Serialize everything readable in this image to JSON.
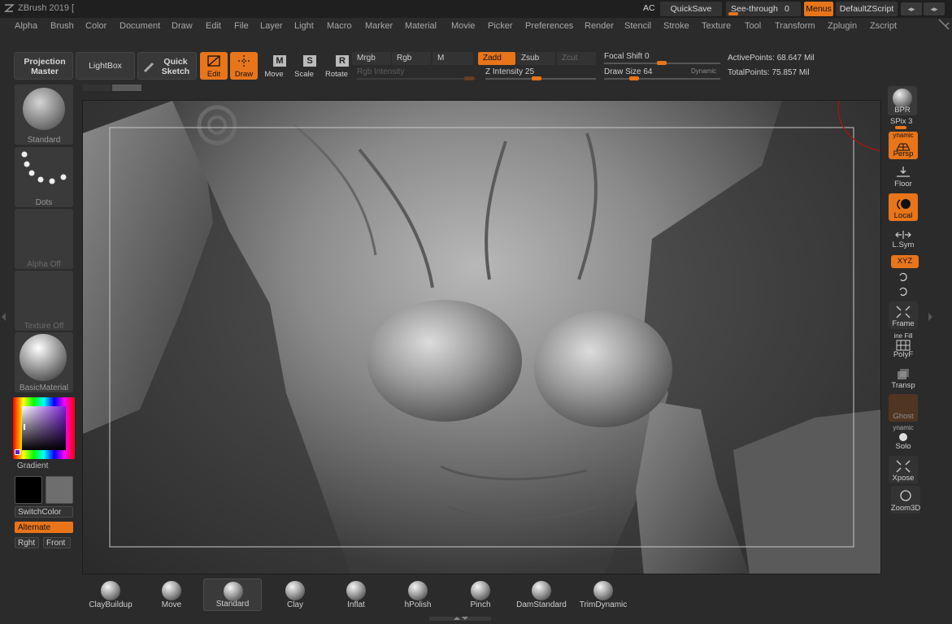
{
  "app": {
    "title": "ZBrush 2019 ["
  },
  "titlebar": {
    "ac_label": "AC",
    "quicksave_label": "QuickSave",
    "seethrough_label": "See-through",
    "seethrough_value": "0",
    "menus_label": "Menus",
    "script_label": "DefaultZScript"
  },
  "menu": {
    "items": [
      "Alpha",
      "Brush",
      "Color",
      "Document",
      "Draw",
      "Edit",
      "File",
      "Layer",
      "Light",
      "Macro",
      "Marker",
      "Material",
      "Movie",
      "Picker",
      "Preferences",
      "Render",
      "Stencil",
      "Stroke",
      "Texture",
      "Tool",
      "Transform",
      "Zplugin",
      "Zscript"
    ]
  },
  "toolbar": {
    "projection_master": "Projection Master",
    "lightbox": "LightBox",
    "quick_sketch": "Quick Sketch",
    "edit": "Edit",
    "draw": "Draw",
    "move": "Move",
    "scale": "Scale",
    "rotate": "Rotate",
    "mrgb": "Mrgb",
    "rgb": "Rgb",
    "m": "M",
    "zadd": "Zadd",
    "zsub": "Zsub",
    "zcut": "Zcut",
    "rgb_intensity": "Rgb Intensity",
    "z_intensity_label": "Z Intensity",
    "z_intensity_value": "25",
    "focal_shift_label": "Focal Shift",
    "focal_shift_value": "0",
    "draw_size_label": "Draw Size",
    "draw_size_value": "64",
    "dynamic": "Dynamic",
    "active_points": "ActivePoints: 68.647 Mil",
    "total_points": "TotalPoints: 75.857 Mil"
  },
  "left_shelf": {
    "brush": "Standard",
    "stroke": "Dots",
    "alpha": "Alpha Off",
    "texture": "Texture Off",
    "material": "BasicMaterial",
    "gradient": "Gradient",
    "switch_color": "SwitchColor",
    "alternate": "Alternate",
    "rght": "Rght",
    "front": "Front"
  },
  "right_shelf": {
    "bpr": "BPR",
    "spix": "SPix 3",
    "dynamic_top": "ynamic",
    "persp": "Persp",
    "floor": "Floor",
    "local": "Local",
    "lsym": "L.Sym",
    "xyz": "XYZ",
    "frame": "Frame",
    "line_fill": "ine Fill",
    "polyf": "PolyF",
    "transp": "Transp",
    "ghost": "Ghost",
    "dynamic_solo": "ynamic",
    "solo": "Solo",
    "xpose": "Xpose",
    "zoom3d": "Zoom3D"
  },
  "bottom_shelf": {
    "brushes": [
      "ClayBuildup",
      "Move",
      "Standard",
      "Clay",
      "Inflat",
      "hPolish",
      "Pinch",
      "DamStandard",
      "TrimDynamic"
    ]
  },
  "colors": {
    "accent": "#e8751a",
    "background": "#2b2b2b",
    "primary_color": "#000000",
    "secondary_color": "#6e6e6e"
  }
}
